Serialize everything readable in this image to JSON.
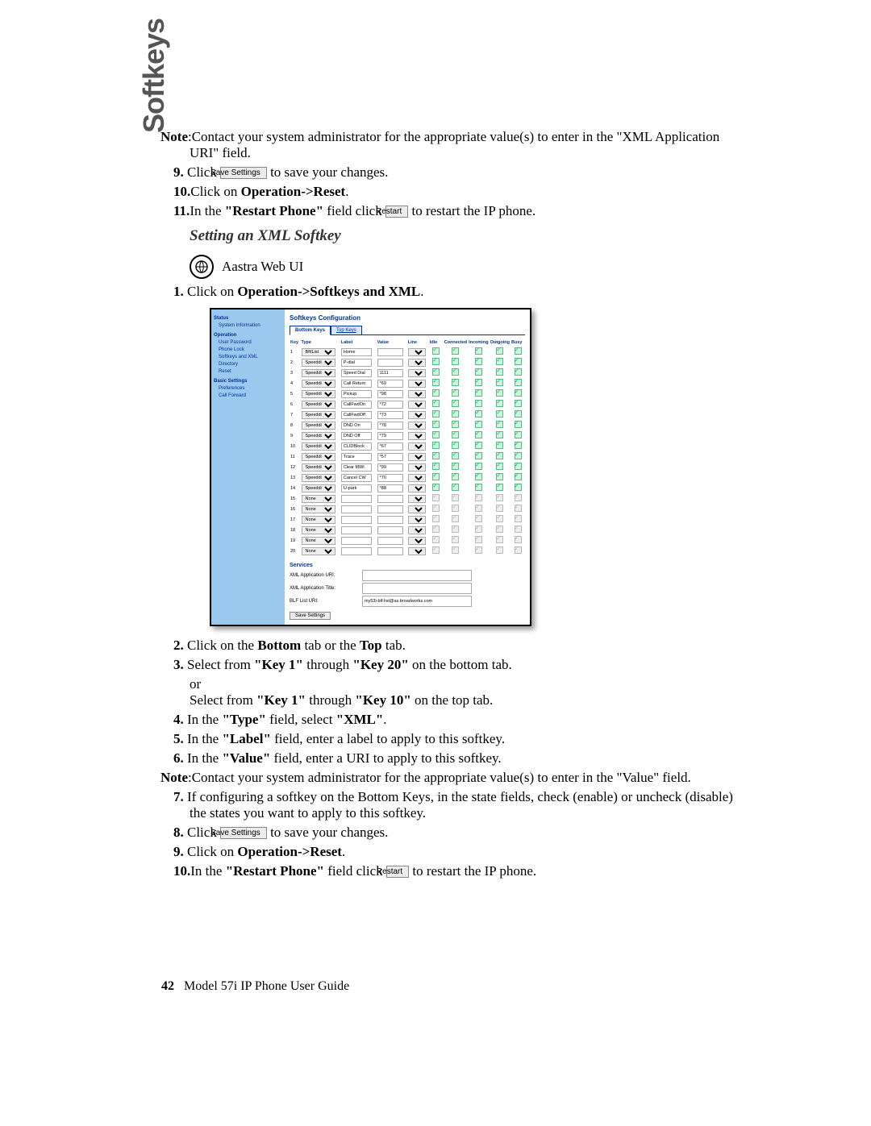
{
  "sideTab": "Softkeys",
  "intro": {
    "noteLabel": "Note",
    "noteText": ":Contact your system administrator for the appropriate value(s) to enter in the \"XML Application URI\" field.",
    "step9_a": "Click",
    "saveBtn": "Save Settings",
    "step9_b": "to save your changes.",
    "step10_a": "Click on ",
    "step10_b": "Operation->Reset",
    "step11_a": "In the ",
    "step11_b": "\"Restart Phone\"",
    "step11_c": " field click ",
    "restartBtn": "Restart",
    "step11_d": " to restart the IP phone."
  },
  "heading": "Setting an XML Softkey",
  "uiLabel": "Aastra Web UI",
  "step1_a": "Click on ",
  "step1_b": "Operation->Softkeys and XML",
  "ss": {
    "sidebar": {
      "cat1": "Status",
      "c1i1": "System Information",
      "cat2": "Operation",
      "c2i1": "User Password",
      "c2i2": "Phone Lock",
      "c2i3": "Softkeys and XML",
      "c2i4": "Directory",
      "c2i5": "Reset",
      "cat3": "Basic Settings",
      "c3i1": "Preferences",
      "c3i2": "Call Forward"
    },
    "title": "Softkeys Configuration",
    "tab1": "Bottom Keys",
    "tab2": "Top Keys",
    "headers": {
      "key": "Key",
      "type": "Type",
      "label": "Label",
      "value": "Value",
      "line": "Line",
      "idle": "Idle",
      "connected": "Connected",
      "incoming": "Incoming",
      "outgoing": "Outgoing",
      "busy": "Busy"
    },
    "rows": [
      {
        "n": "1",
        "type": "Blf/List",
        "label": "Home",
        "value": "",
        "line": "1",
        "en": true
      },
      {
        "n": "2",
        "type": "Speeddial",
        "label": "P-dial",
        "value": "",
        "line": "1",
        "en": true
      },
      {
        "n": "3",
        "type": "Speeddial",
        "label": "Speed Dial",
        "value": "1111",
        "line": "1",
        "en": true
      },
      {
        "n": "4",
        "type": "Speeddial",
        "label": "Call Return",
        "value": "*69",
        "line": "1",
        "en": true
      },
      {
        "n": "5",
        "type": "Speeddial",
        "label": "Pickup",
        "value": "*98",
        "line": "1",
        "en": true
      },
      {
        "n": "6",
        "type": "Speeddial",
        "label": "CallFwdOn",
        "value": "*72",
        "line": "1",
        "en": true
      },
      {
        "n": "7",
        "type": "Speeddial",
        "label": "CallFwdOff",
        "value": "*73",
        "line": "1",
        "en": true
      },
      {
        "n": "8",
        "type": "Speeddial",
        "label": "DND On",
        "value": "*78",
        "line": "1",
        "en": true
      },
      {
        "n": "9",
        "type": "Speeddial",
        "label": "DND Off",
        "value": "*79",
        "line": "1",
        "en": true
      },
      {
        "n": "10",
        "type": "Speeddial",
        "label": "CLIDBlock",
        "value": "*67",
        "line": "1",
        "en": true
      },
      {
        "n": "11",
        "type": "Speeddial",
        "label": "Trace",
        "value": "*57",
        "line": "1",
        "en": true
      },
      {
        "n": "12",
        "type": "Speeddial",
        "label": "Clear MWI",
        "value": "*99",
        "line": "1",
        "en": true
      },
      {
        "n": "13",
        "type": "Speeddial",
        "label": "Cancel CW",
        "value": "*70",
        "line": "1",
        "en": true
      },
      {
        "n": "14",
        "type": "Speeddial",
        "label": "U-park",
        "value": "*88",
        "line": "1",
        "en": true
      },
      {
        "n": "15",
        "type": "None",
        "label": "",
        "value": "",
        "line": "1",
        "en": false
      },
      {
        "n": "16",
        "type": "None",
        "label": "",
        "value": "",
        "line": "1",
        "en": false
      },
      {
        "n": "17",
        "type": "None",
        "label": "",
        "value": "",
        "line": "1",
        "en": false
      },
      {
        "n": "18",
        "type": "None",
        "label": "",
        "value": "",
        "line": "1",
        "en": false
      },
      {
        "n": "19",
        "type": "None",
        "label": "",
        "value": "",
        "line": "1",
        "en": false
      },
      {
        "n": "20",
        "type": "None",
        "label": "",
        "value": "",
        "line": "1",
        "en": false
      }
    ],
    "services": "Services",
    "svc1": "XML Application URI:",
    "svc2": "XML Application Title:",
    "svc3": "BLF List URI:",
    "svc3val": "my53i-blf-list@as.broadworks.com",
    "saveBtn": "Save Settings"
  },
  "post": {
    "s2_a": "Click on the ",
    "s2_b": "Bottom",
    "s2_c": " tab or the ",
    "s2_d": "Top",
    "s2_e": " tab.",
    "s3_a": "Select from ",
    "s3_b": "\"Key 1\"",
    "s3_c": " through ",
    "s3_d": "\"Key 20\"",
    "s3_e": " on the bottom tab.",
    "s3_or": "or",
    "s3f_a": "Select from ",
    "s3f_b": "\"Key 1\"",
    "s3f_c": " through ",
    "s3f_d": "\"Key 10\"",
    "s3f_e": " on the top tab.",
    "s4_a": "In the ",
    "s4_b": "\"Type\"",
    "s4_c": " field, select ",
    "s4_d": "\"XML\"",
    "s4_e": ".",
    "s5_a": "In the ",
    "s5_b": "\"Label\"",
    "s5_c": " field, enter a label to apply to this softkey.",
    "s6_a": "In the ",
    "s6_b": "\"Value\"",
    "s6_c": " field, enter a URI to apply to this softkey.",
    "noteLabel": "Note",
    "noteText": ":Contact your system administrator for the appropriate value(s) to enter in the \"Value\" field.",
    "s7": "If configuring a softkey on the Bottom Keys, in the state fields, check (enable) or uncheck (disable) the states you want to apply to this softkey.",
    "s8_a": "Click ",
    "s8_b": " to save your changes.",
    "s9_a": "Click on ",
    "s9_b": "Operation->Reset",
    "s9_c": ".",
    "s10_a": "In the ",
    "s10_b": "\"Restart Phone\"",
    "s10_c": " field click ",
    "s10_d": " to restart the IP phone."
  },
  "footer": {
    "page": "42",
    "model": "Model 57i ",
    "rest": "IP Phone User Guide"
  }
}
